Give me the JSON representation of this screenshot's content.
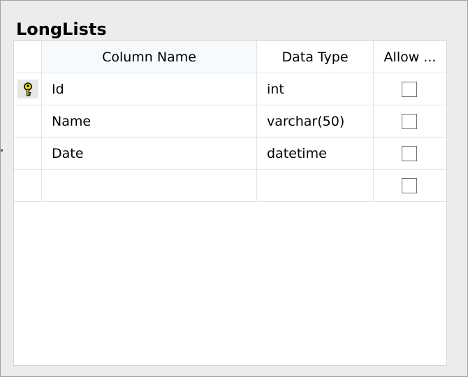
{
  "table": {
    "name": "LongLists",
    "columns_header": {
      "column_name": "Column Name",
      "data_type": "Data Type",
      "allow_nulls": "Allow ..."
    },
    "rows": [
      {
        "name": "Id",
        "type": "int",
        "allow_nulls": false,
        "primary_key": true
      },
      {
        "name": "Name",
        "type": "varchar(50)",
        "allow_nulls": false,
        "primary_key": false
      },
      {
        "name": "Date",
        "type": "datetime",
        "allow_nulls": false,
        "primary_key": false
      },
      {
        "name": "",
        "type": "",
        "allow_nulls": false,
        "primary_key": false
      }
    ]
  },
  "icons": {
    "primary_key": "key-icon"
  },
  "colors": {
    "key_yellow": "#f0e000"
  }
}
